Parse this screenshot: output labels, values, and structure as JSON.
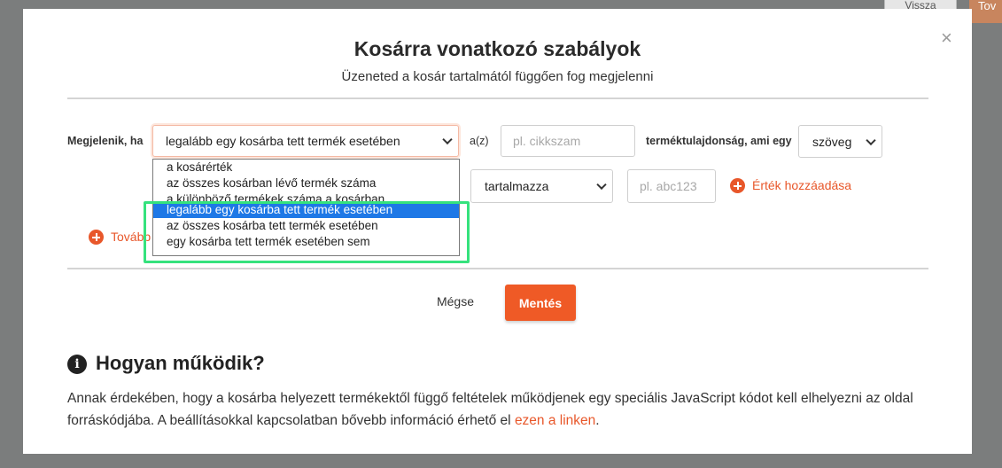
{
  "background": {
    "back_button": "Vissza",
    "next_button": "Tov"
  },
  "modal": {
    "title": "Kosárra vonatkozó szabályok",
    "subtitle": "Üzeneted a kosár tartalmától függően fog megjelenni",
    "close_icon": "×",
    "rule": {
      "label_show_if": "Megjelenik, ha",
      "condition_select": "legalább egy kosárba tett termék esetében",
      "label_az": "a(z)",
      "field_placeholder": "pl. cikkszam",
      "label_attribute": "terméktulajdonság, ami egy",
      "type_select": "szöveg",
      "operator_select": "tartalmazza",
      "value_placeholder": "pl. abc123",
      "add_value": "Érték hozzáadása",
      "add_more_partial": "Tovább"
    },
    "dropdown_options": [
      "a kosárérték",
      "az összes kosárban lévő termék száma",
      "a különböző termékek száma a kosárban",
      "legalább egy kosárba tett termék esetében",
      "az összes kosárba tett termék esetében",
      "egy kosárba tett termék esetében sem"
    ],
    "selected_option_index": 3,
    "buttons": {
      "cancel": "Mégse",
      "save": "Mentés"
    },
    "how": {
      "title": "Hogyan működik?",
      "icon": "info-icon",
      "text": "Annak érdekében, hogy a kosárba helyezett termékektől függő feltételek működjenek egy speciális JavaScript kódot kell elhelyezni az oldal forráskódjába. A beállításokkal kapcsolatban bővebb információ érhető el ",
      "link": "ezen a linken",
      "text_end": "."
    }
  },
  "colors": {
    "accent": "#ef5a26",
    "highlight": "#35e27d",
    "selected_option": "#1e78e6"
  }
}
